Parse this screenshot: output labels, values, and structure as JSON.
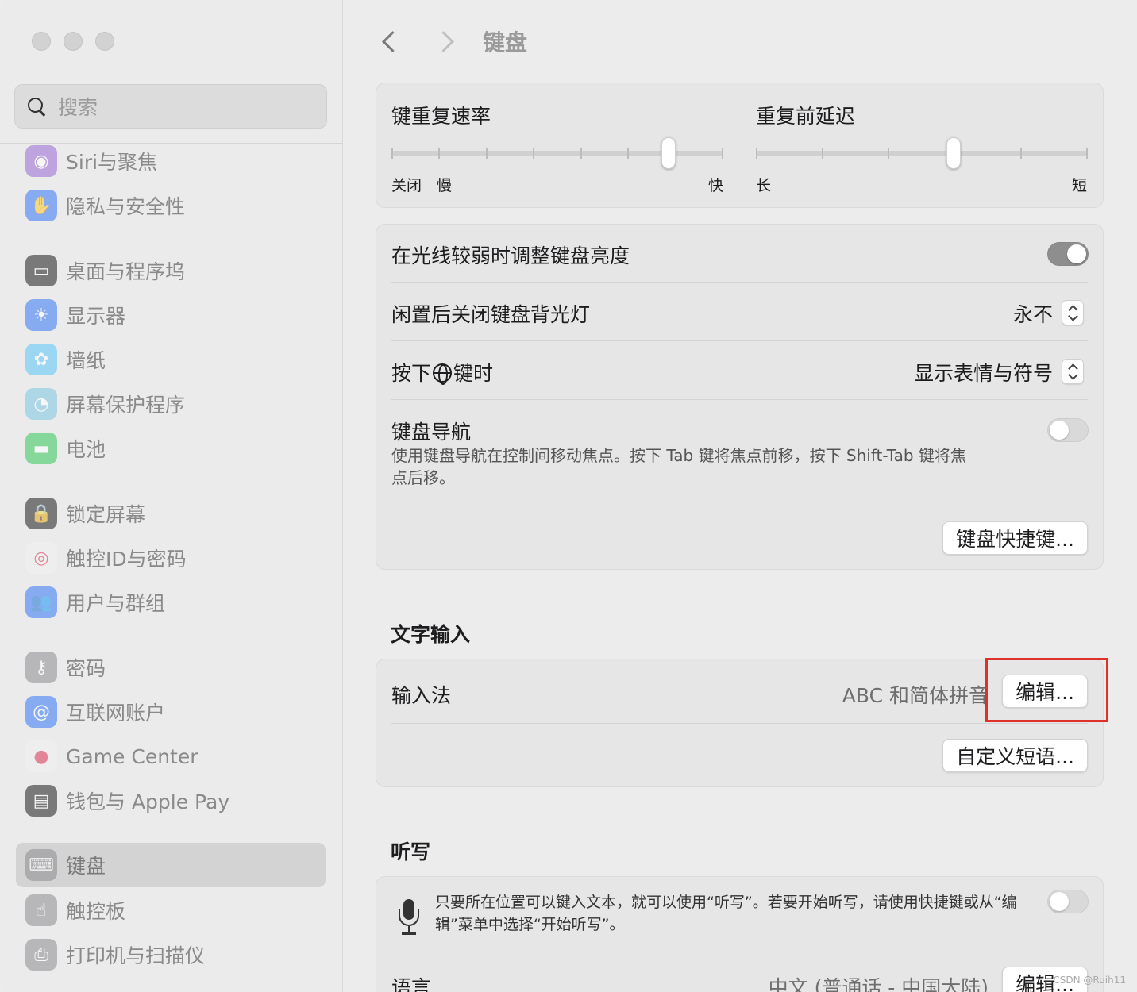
{
  "window": {
    "title": "键盘"
  },
  "sidebar": {
    "search_placeholder": "搜索",
    "items": [
      {
        "label": "Siri与聚焦",
        "icon": "siri-icon",
        "color": "#9b6bd6"
      },
      {
        "label": "隐私与安全性",
        "icon": "hand-icon",
        "color": "#3478f6"
      },
      {
        "label": "桌面与程序坞",
        "icon": "dock-icon",
        "color": "#1d1d1f"
      },
      {
        "label": "显示器",
        "icon": "sun-icon",
        "color": "#3478f6"
      },
      {
        "label": "墙纸",
        "icon": "flower-icon",
        "color": "#5ac8fa"
      },
      {
        "label": "屏幕保护程序",
        "icon": "screensaver-icon",
        "color": "#7ec8e3"
      },
      {
        "label": "电池",
        "icon": "battery-icon",
        "color": "#34c759"
      },
      {
        "label": "锁定屏幕",
        "icon": "lock-icon",
        "color": "#1d1d1f"
      },
      {
        "label": "触控ID与密码",
        "icon": "fingerprint-icon",
        "color": "#f2f2f2"
      },
      {
        "label": "用户与群组",
        "icon": "users-icon",
        "color": "#3478f6"
      },
      {
        "label": "密码",
        "icon": "key-icon",
        "color": "#8e8e93"
      },
      {
        "label": "互联网账户",
        "icon": "at-icon",
        "color": "#3478f6"
      },
      {
        "label": "Game Center",
        "icon": "game-center-icon",
        "color": "#f2f2f2"
      },
      {
        "label": "钱包与 Apple Pay",
        "icon": "wallet-icon",
        "color": "#1d1d1f"
      },
      {
        "label": "键盘",
        "icon": "keyboard-icon",
        "color": "#8e8e93",
        "active": true
      },
      {
        "label": "触控板",
        "icon": "trackpad-icon",
        "color": "#8e8e93"
      },
      {
        "label": "打印机与扫描仪",
        "icon": "printer-icon",
        "color": "#8e8e93"
      }
    ]
  },
  "main": {
    "title": "键盘",
    "repeat": {
      "rate_label": "键重复速率",
      "rate_min_off": "关闭",
      "rate_min": "慢",
      "rate_max": "快",
      "rate_value": 0.85,
      "delay_label": "重复前延迟",
      "delay_min": "长",
      "delay_max": "短",
      "delay_value": 0.6
    },
    "brightness_label": "在光线较弱时调整键盘亮度",
    "brightness_on": true,
    "backlight_label": "闲置后关闭键盘背光灯",
    "backlight_value": "永不",
    "globe_label_pre": "按下",
    "globe_label_post": "键时",
    "globe_value": "显示表情与符号",
    "nav_label": "键盘导航",
    "nav_desc": "使用键盘导航在控制间移动焦点。按下 Tab 键将焦点前移，按下 Shift-Tab 键将焦点后移。",
    "nav_on": false,
    "shortcuts_button": "键盘快捷键...",
    "text_input": {
      "section": "文字输入",
      "input_label": "输入法",
      "input_value": "ABC 和简体拼音",
      "edit_button": "编辑...",
      "phrases_button": "自定义短语..."
    },
    "dictation": {
      "section": "听写",
      "desc": "只要所在位置可以键入文本，就可以使用“听写”。若要开始听写，请使用快捷键或从“编辑”菜单中选择“开始听写”。",
      "on": false,
      "language_label": "语言",
      "language_value": "中文 (普通话 - 中国大陆)",
      "edit_button": "编辑..."
    }
  },
  "watermark": "CSDN @Ruih11",
  "colors": {
    "highlight": "#e0302a"
  }
}
